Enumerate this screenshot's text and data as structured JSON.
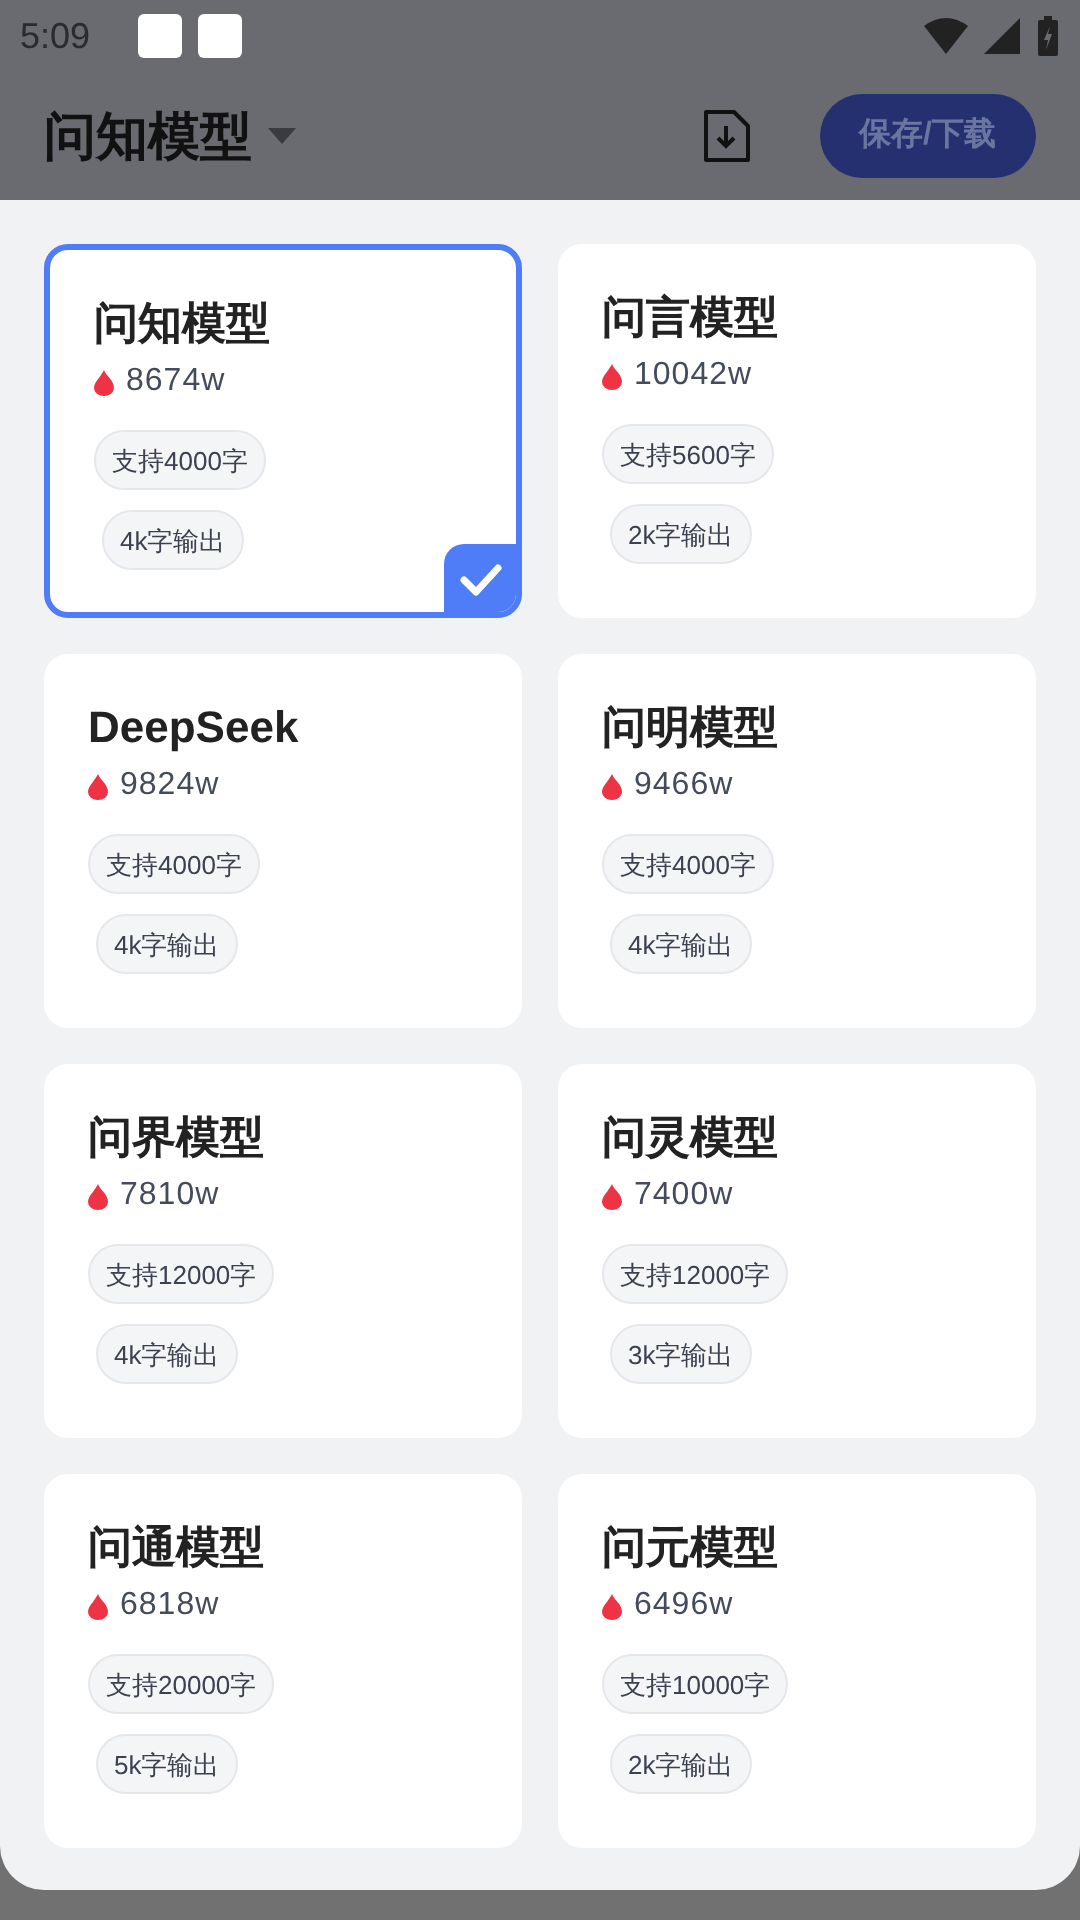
{
  "status_bar": {
    "time": "5:09"
  },
  "header": {
    "title": "问知模型",
    "save_button": "保存/下载"
  },
  "models": [
    {
      "name": "问知模型",
      "heat": "8674w",
      "tags": [
        "支持4000字",
        "4k字输出"
      ],
      "selected": true
    },
    {
      "name": "问言模型",
      "heat": "10042w",
      "tags": [
        "支持5600字",
        "2k字输出"
      ],
      "selected": false
    },
    {
      "name": "DeepSeek",
      "heat": "9824w",
      "tags": [
        "支持4000字",
        "4k字输出"
      ],
      "selected": false
    },
    {
      "name": "问明模型",
      "heat": "9466w",
      "tags": [
        "支持4000字",
        "4k字输出"
      ],
      "selected": false
    },
    {
      "name": "问界模型",
      "heat": "7810w",
      "tags": [
        "支持12000字",
        "4k字输出"
      ],
      "selected": false
    },
    {
      "name": "问灵模型",
      "heat": "7400w",
      "tags": [
        "支持12000字",
        "3k字输出"
      ],
      "selected": false
    },
    {
      "name": "问通模型",
      "heat": "6818w",
      "tags": [
        "支持20000字",
        "5k字输出"
      ],
      "selected": false
    },
    {
      "name": "问元模型",
      "heat": "6496w",
      "tags": [
        "支持10000字",
        "2k字输出"
      ],
      "selected": false
    }
  ]
}
